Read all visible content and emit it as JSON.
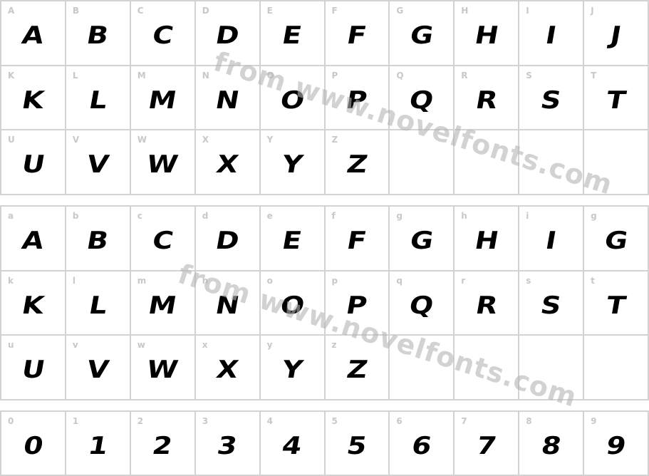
{
  "upper_grid": {
    "cells": [
      {
        "label": "A",
        "glyph": "A"
      },
      {
        "label": "B",
        "glyph": "B"
      },
      {
        "label": "C",
        "glyph": "C"
      },
      {
        "label": "D",
        "glyph": "D"
      },
      {
        "label": "E",
        "glyph": "E"
      },
      {
        "label": "F",
        "glyph": "F"
      },
      {
        "label": "G",
        "glyph": "G"
      },
      {
        "label": "H",
        "glyph": "H"
      },
      {
        "label": "I",
        "glyph": "I"
      },
      {
        "label": "J",
        "glyph": "J"
      },
      {
        "label": "K",
        "glyph": "K"
      },
      {
        "label": "L",
        "glyph": "L"
      },
      {
        "label": "M",
        "glyph": "M"
      },
      {
        "label": "N",
        "glyph": "N"
      },
      {
        "label": "O",
        "glyph": "O"
      },
      {
        "label": "P",
        "glyph": "P"
      },
      {
        "label": "Q",
        "glyph": "Q"
      },
      {
        "label": "R",
        "glyph": "R"
      },
      {
        "label": "S",
        "glyph": "S"
      },
      {
        "label": "T",
        "glyph": "T"
      },
      {
        "label": "U",
        "glyph": "U"
      },
      {
        "label": "V",
        "glyph": "V"
      },
      {
        "label": "W",
        "glyph": "W"
      },
      {
        "label": "X",
        "glyph": "X"
      },
      {
        "label": "Y",
        "glyph": "Y"
      },
      {
        "label": "Z",
        "glyph": "Z"
      },
      {
        "label": "",
        "glyph": ""
      },
      {
        "label": "",
        "glyph": ""
      },
      {
        "label": "",
        "glyph": ""
      },
      {
        "label": "",
        "glyph": ""
      }
    ]
  },
  "lower_grid": {
    "cells": [
      {
        "label": "a",
        "glyph": "A"
      },
      {
        "label": "b",
        "glyph": "B"
      },
      {
        "label": "c",
        "glyph": "C"
      },
      {
        "label": "d",
        "glyph": "D"
      },
      {
        "label": "e",
        "glyph": "E"
      },
      {
        "label": "f",
        "glyph": "F"
      },
      {
        "label": "g",
        "glyph": "G"
      },
      {
        "label": "h",
        "glyph": "H"
      },
      {
        "label": "i",
        "glyph": "I"
      },
      {
        "label": "g",
        "glyph": "G"
      },
      {
        "label": "k",
        "glyph": "K"
      },
      {
        "label": "l",
        "glyph": "L"
      },
      {
        "label": "m",
        "glyph": "M"
      },
      {
        "label": "n",
        "glyph": "N"
      },
      {
        "label": "o",
        "glyph": "O"
      },
      {
        "label": "p",
        "glyph": "P"
      },
      {
        "label": "q",
        "glyph": "Q"
      },
      {
        "label": "r",
        "glyph": "R"
      },
      {
        "label": "s",
        "glyph": "S"
      },
      {
        "label": "t",
        "glyph": "T"
      },
      {
        "label": "u",
        "glyph": "U"
      },
      {
        "label": "v",
        "glyph": "V"
      },
      {
        "label": "w",
        "glyph": "W"
      },
      {
        "label": "x",
        "glyph": "X"
      },
      {
        "label": "y",
        "glyph": "Y"
      },
      {
        "label": "z",
        "glyph": "Z"
      },
      {
        "label": "",
        "glyph": ""
      },
      {
        "label": "",
        "glyph": ""
      },
      {
        "label": "",
        "glyph": ""
      },
      {
        "label": "",
        "glyph": ""
      }
    ]
  },
  "digit_grid": {
    "cells": [
      {
        "label": "0",
        "glyph": "0"
      },
      {
        "label": "1",
        "glyph": "1"
      },
      {
        "label": "2",
        "glyph": "2"
      },
      {
        "label": "3",
        "glyph": "3"
      },
      {
        "label": "4",
        "glyph": "4"
      },
      {
        "label": "5",
        "glyph": "5"
      },
      {
        "label": "6",
        "glyph": "6"
      },
      {
        "label": "7",
        "glyph": "7"
      },
      {
        "label": "8",
        "glyph": "8"
      },
      {
        "label": "9",
        "glyph": "9"
      }
    ]
  },
  "watermark": {
    "text": "from www.novelfonts.com"
  },
  "colors": {
    "grid_line": "#d3d3d3",
    "label": "#c8c8c8",
    "glyph": "#000000",
    "watermark": "#b4b4b4"
  }
}
